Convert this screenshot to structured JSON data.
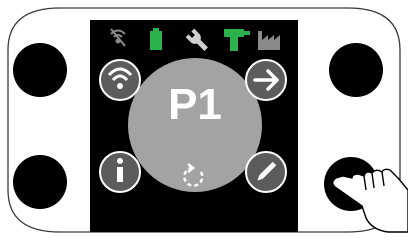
{
  "screen": {
    "program_label": "P1"
  },
  "status_bar": {
    "icons": [
      {
        "name": "no-wireless-icon",
        "color": "#8a8a8a"
      },
      {
        "name": "battery-icon",
        "color": "#2bb24c"
      },
      {
        "name": "wrench-icon",
        "color": "#d0d0d0"
      },
      {
        "name": "drill-tool-icon",
        "color": "#2bb24c"
      },
      {
        "name": "factory-icon",
        "color": "#8a8a8a"
      }
    ]
  },
  "buttons": {
    "top_left": "wireless-icon",
    "top_right": "arrow-right-icon",
    "bottom_left": "info-icon",
    "bottom_right": "pencil-icon",
    "center": "refresh-icon"
  },
  "colors": {
    "screen_background": "#000000",
    "center_circle": "#a3a3a3",
    "side_circles": "#5c5c5c",
    "accent_green": "#2bb24c",
    "hardware_button": "#000000"
  }
}
